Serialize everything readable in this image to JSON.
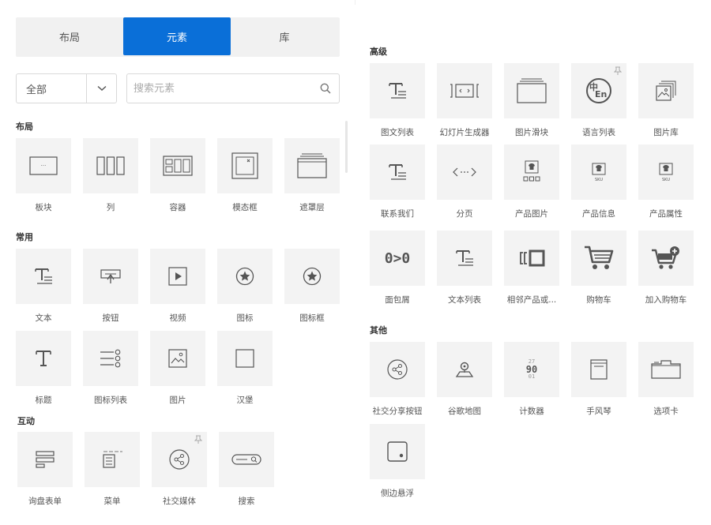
{
  "tabs": [
    {
      "label": "布局",
      "active": false
    },
    {
      "label": "元素",
      "active": true
    },
    {
      "label": "库",
      "active": false
    }
  ],
  "filter": {
    "selected": "全部",
    "search_placeholder": "搜索元素"
  },
  "colors": {
    "accent": "#0a6fd8",
    "tile_bg": "#f3f3f3",
    "icon": "#555555"
  },
  "left": {
    "layout": {
      "title": "布局",
      "items": [
        {
          "label": "板块",
          "icon": "section-icon"
        },
        {
          "label": "列",
          "icon": "columns-icon"
        },
        {
          "label": "容器",
          "icon": "container-icon"
        },
        {
          "label": "模态框",
          "icon": "modal-icon"
        },
        {
          "label": "遮罩层",
          "icon": "overlay-icon"
        }
      ]
    },
    "common": {
      "title": "常用",
      "items": [
        {
          "label": "文本",
          "icon": "text-icon"
        },
        {
          "label": "按钮",
          "icon": "button-icon"
        },
        {
          "label": "视频",
          "icon": "video-icon"
        },
        {
          "label": "图标",
          "icon": "star-icon"
        },
        {
          "label": "图标框",
          "icon": "star-icon"
        },
        {
          "label": "标题",
          "icon": "heading-icon"
        },
        {
          "label": "图标列表",
          "icon": "icon-list-icon"
        },
        {
          "label": "图片",
          "icon": "image-icon"
        },
        {
          "label": "汉堡",
          "icon": "square-icon"
        }
      ]
    },
    "interactive": {
      "title": "互动",
      "items": [
        {
          "label": "询盘表单",
          "icon": "form-icon"
        },
        {
          "label": "菜单",
          "icon": "menu-icon"
        },
        {
          "label": "社交媒体",
          "icon": "share-icon",
          "pinned": true
        },
        {
          "label": "搜索",
          "icon": "search-bar-icon"
        }
      ]
    }
  },
  "right": {
    "advanced": {
      "title": "高级",
      "items": [
        {
          "label": "图文列表",
          "icon": "text-icon"
        },
        {
          "label": "幻灯片生成器",
          "icon": "slider-icon"
        },
        {
          "label": "图片滑块",
          "icon": "image-slider-icon"
        },
        {
          "label": "语言列表",
          "icon": "language-icon",
          "pinned": true
        },
        {
          "label": "图片库",
          "icon": "gallery-icon"
        },
        {
          "label": "联系我们",
          "icon": "text-icon"
        },
        {
          "label": "分页",
          "icon": "pagination-icon"
        },
        {
          "label": "产品图片",
          "icon": "product-image-icon"
        },
        {
          "label": "产品信息",
          "icon": "product-info-icon"
        },
        {
          "label": "产品属性",
          "icon": "product-attr-icon"
        },
        {
          "label": "面包屑",
          "icon": "breadcrumb-icon"
        },
        {
          "label": "文本列表",
          "icon": "text-icon"
        },
        {
          "label": "相邻产品或...",
          "icon": "adjacent-icon"
        },
        {
          "label": "购物车",
          "icon": "cart-icon"
        },
        {
          "label": "加入购物车",
          "icon": "add-cart-icon"
        }
      ]
    },
    "other": {
      "title": "其他",
      "items": [
        {
          "label": "社交分享按钮",
          "icon": "share-icon"
        },
        {
          "label": "谷歌地图",
          "icon": "map-icon"
        },
        {
          "label": "计数器",
          "icon": "counter-icon"
        },
        {
          "label": "手风琴",
          "icon": "accordion-icon"
        },
        {
          "label": "选项卡",
          "icon": "tabs-icon"
        },
        {
          "label": "侧边悬浮",
          "icon": "float-icon"
        }
      ]
    },
    "icon_text": {
      "language_cn": "中",
      "language_en": "En",
      "sku1": "SKU",
      "sku2": "SKU",
      "breadcrumb": "0>0",
      "counter_top": "27",
      "counter_mid": "90",
      "counter_bot": "01"
    }
  }
}
